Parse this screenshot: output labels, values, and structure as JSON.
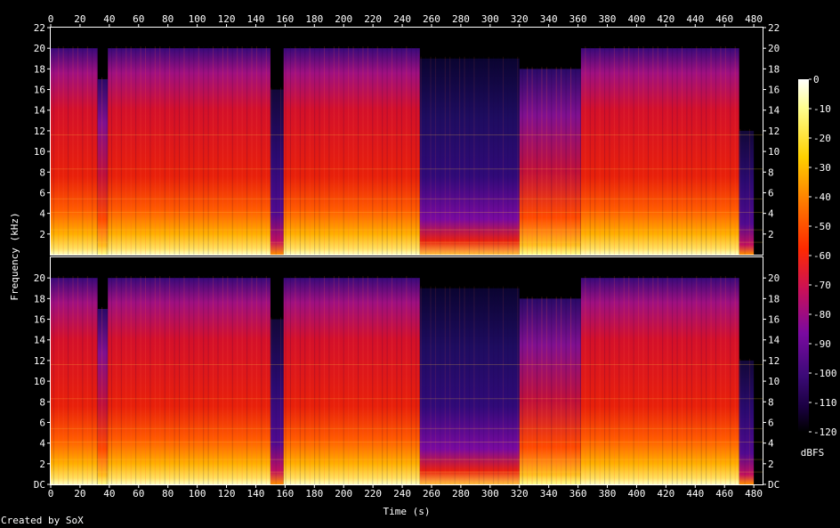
{
  "chart_data": {
    "type": "heatmap",
    "title": "",
    "xlabel": "Time (s)",
    "ylabel": "Frequency (kHz)",
    "xlim": [
      0,
      486
    ],
    "ylim": [
      0,
      22
    ],
    "x_ticks": [
      0,
      20,
      40,
      60,
      80,
      100,
      120,
      140,
      160,
      180,
      200,
      220,
      240,
      260,
      280,
      300,
      320,
      340,
      360,
      380,
      400,
      420,
      440,
      460,
      480
    ],
    "y_ticks_top": [
      "2",
      "4",
      "6",
      "8",
      "10",
      "12",
      "14",
      "16",
      "18",
      "20",
      "22"
    ],
    "y_ticks_bottom": [
      "DC",
      "2",
      "4",
      "6",
      "8",
      "10",
      "12",
      "14",
      "16",
      "18",
      "20"
    ],
    "channels": 2,
    "colorbar": {
      "label": "dBFS",
      "range": [
        -120,
        0
      ],
      "ticks": [
        "0",
        "-10",
        "-20",
        "-30",
        "-40",
        "-50",
        "-60",
        "-70",
        "-80",
        "-90",
        "-100",
        "-110",
        "-120"
      ]
    },
    "segments": [
      {
        "start": 0,
        "end": 32,
        "level": "loud",
        "cutoff_khz": 20
      },
      {
        "start": 32,
        "end": 39,
        "level": "medium",
        "cutoff_khz": 17
      },
      {
        "start": 39,
        "end": 150,
        "level": "loud",
        "cutoff_khz": 20
      },
      {
        "start": 150,
        "end": 159,
        "level": "fade",
        "cutoff_khz": 16
      },
      {
        "start": 159,
        "end": 252,
        "level": "loud",
        "cutoff_khz": 20
      },
      {
        "start": 252,
        "end": 320,
        "level": "quiet",
        "cutoff_khz": 19
      },
      {
        "start": 320,
        "end": 362,
        "level": "medium",
        "cutoff_khz": 18
      },
      {
        "start": 362,
        "end": 470,
        "level": "loud",
        "cutoff_khz": 20
      },
      {
        "start": 470,
        "end": 480,
        "level": "fade",
        "cutoff_khz": 12
      }
    ]
  },
  "footer": {
    "credit": "Created by SoX"
  },
  "colors": {
    "background": "#000000",
    "text": "#ffffff",
    "palette": [
      "#000000",
      "#1a0040",
      "#3c0a78",
      "#7a0aa0",
      "#c8105a",
      "#ff2a00",
      "#ff7a00",
      "#ffd000",
      "#ffff90",
      "#ffffff"
    ]
  }
}
